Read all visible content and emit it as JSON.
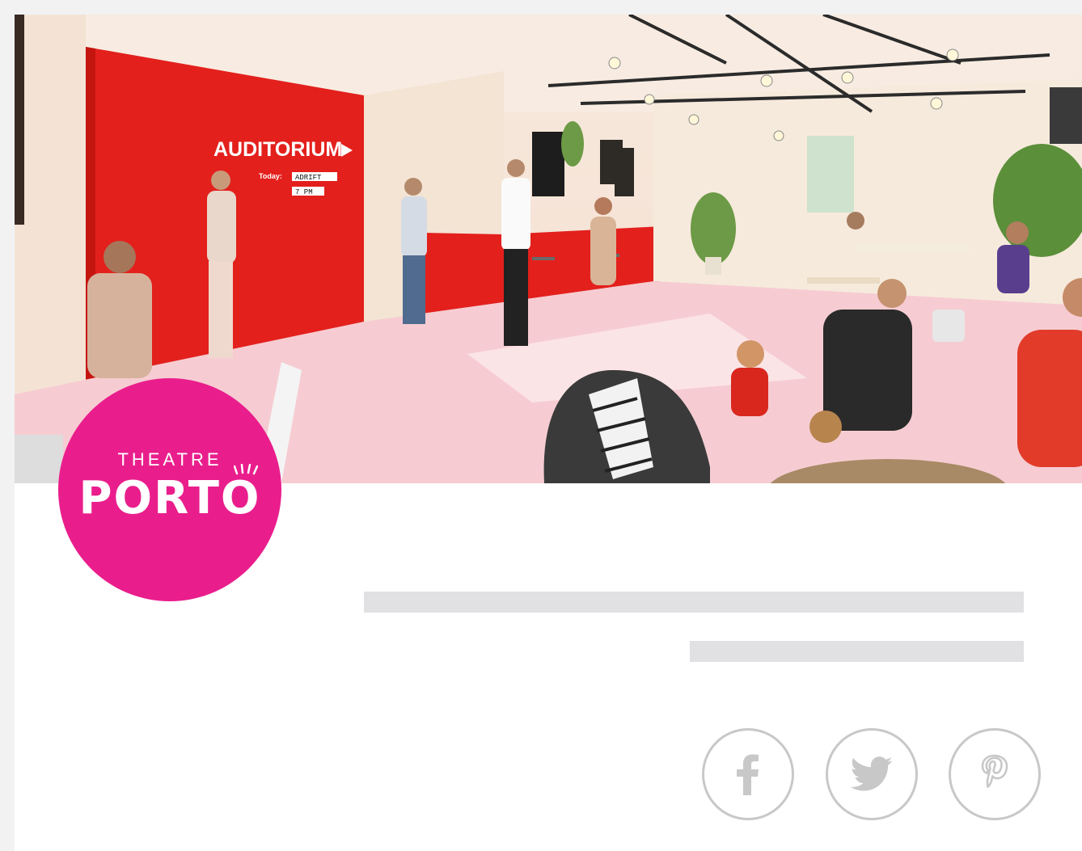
{
  "hero": {
    "image_name": "theatre-lobby-illustration",
    "signage": {
      "auditorium": "AUDITORIUM",
      "today_label": "Today:",
      "show_name": "ADRIFT",
      "show_time": "7 PM"
    }
  },
  "logo": {
    "line1": "THEATRE",
    "line2": "PORTO",
    "color": "#e91e8c"
  },
  "social": {
    "facebook_icon": "facebook-icon",
    "twitter_icon": "twitter-icon",
    "pinterest_icon": "pinterest-icon",
    "icon_color": "#c8c8c8"
  }
}
